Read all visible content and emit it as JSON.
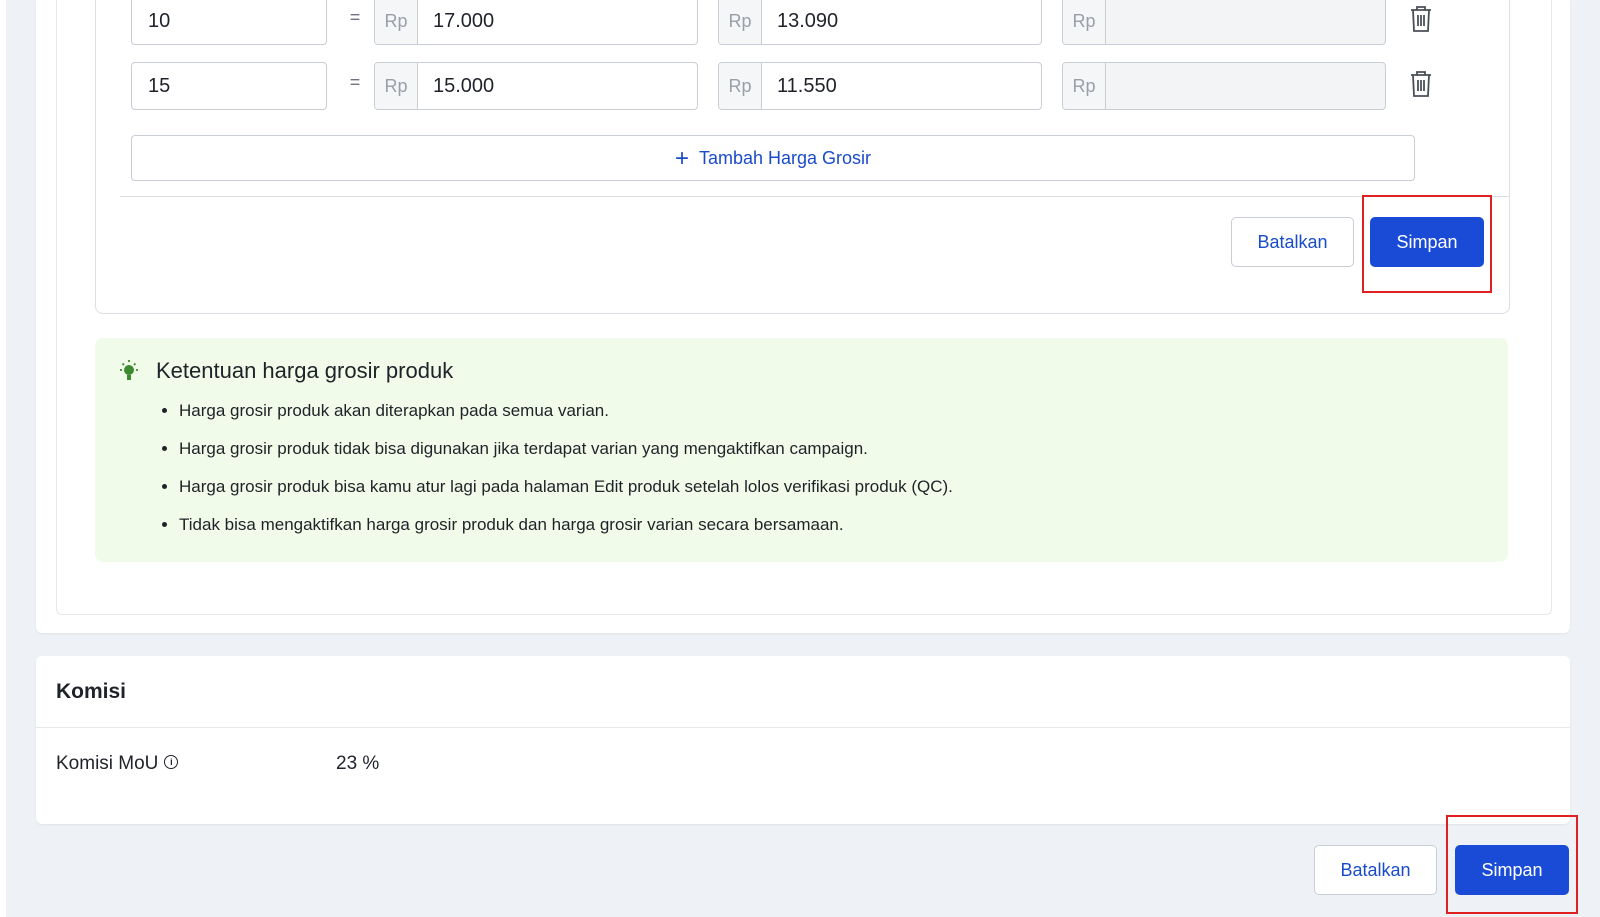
{
  "grosir": {
    "rows": [
      {
        "qty": "10",
        "equals": "=",
        "currency": "Rp",
        "price": "17.000",
        "net_price": "13.090",
        "empty_price": ""
      },
      {
        "qty": "15",
        "equals": "=",
        "currency": "Rp",
        "price": "15.000",
        "net_price": "11.550",
        "empty_price": ""
      }
    ],
    "add_button_label": "Tambah Harga Grosir",
    "cancel_label": "Batalkan",
    "save_label": "Simpan"
  },
  "info": {
    "title": "Ketentuan harga grosir produk",
    "items": [
      "Harga grosir produk akan diterapkan pada semua varian.",
      "Harga grosir produk tidak bisa digunakan jika terdapat varian yang mengaktifkan campaign.",
      "Harga grosir produk bisa kamu atur lagi pada halaman Edit produk setelah lolos verifikasi produk (QC).",
      "Tidak bisa mengaktifkan harga grosir produk dan harga grosir varian secara bersamaan."
    ]
  },
  "komisi": {
    "title": "Komisi",
    "label": "Komisi MoU",
    "value": "23 %"
  },
  "footer": {
    "cancel_label": "Batalkan",
    "save_label": "Simpan"
  },
  "colors": {
    "primary": "#1a4bd6",
    "link": "#1a4bc9",
    "info_bg": "#f1fbe9",
    "highlight": "#e02020"
  }
}
